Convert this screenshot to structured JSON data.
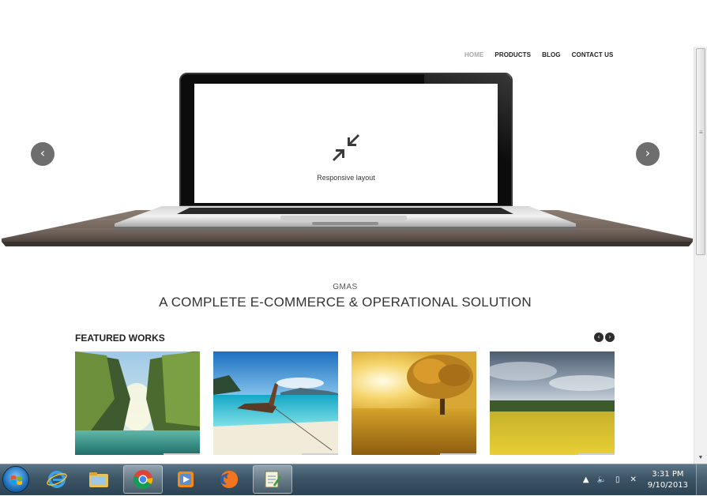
{
  "nav": {
    "items": [
      "HOME",
      "PRODUCTS",
      "BLOG",
      "CONTACT US"
    ],
    "active_index": 0
  },
  "hero": {
    "slide_caption": "Responsive layout",
    "slide_icon": "compress-arrows-icon",
    "prev_label": "‹",
    "next_label": "›"
  },
  "intro": {
    "brand": "GMAS",
    "headline": "A COMPLETE E-COMMERCE & OPERATIONAL SOLUTION"
  },
  "featured": {
    "title": "FEATURED WORKS",
    "prev_label": "‹",
    "next_label": "›",
    "items": [
      {
        "icon": "tropical-cliffs-photo"
      },
      {
        "icon": "longtail-boat-beach-photo"
      },
      {
        "icon": "golden-tree-field-photo"
      },
      {
        "icon": "rapeseed-field-photo"
      }
    ]
  },
  "taskbar": {
    "apps": [
      "start-button",
      "internet-explorer-icon",
      "file-explorer-icon",
      "chrome-icon",
      "media-player-icon",
      "firefox-icon",
      "notepad-icon"
    ],
    "active_app": "chrome-icon",
    "clock_time": "3:31 PM",
    "clock_date": "9/10/2013"
  },
  "colors": {
    "accent_dark": "#2d2d2d",
    "nav_active": "#a8a8a8",
    "taskbar": "#3c5566"
  }
}
